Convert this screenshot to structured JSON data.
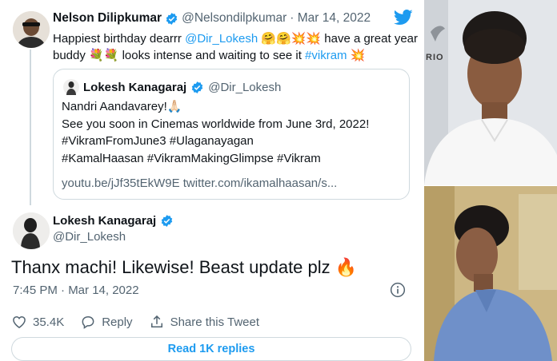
{
  "tweet": {
    "author_name": "Nelson Dilipkumar",
    "author_handle": "@Nelsondilpkumar",
    "date": "· Mar 14, 2022",
    "text_line1_prefix": "Happiest birthday dearrr ",
    "mention": "@Dir_Lokesh",
    "text_line1_suffix": " have a great year",
    "text_line2_prefix": "buddy ",
    "text_line2_middle": " looks intense and waiting to see it ",
    "hashtag": "#vikram"
  },
  "quote": {
    "author_name": "Lokesh Kanagaraj",
    "author_handle": "@Dir_Lokesh",
    "line1": "Nandri Aandavarey!🙏🏻",
    "line2": "See you soon in Cinemas worldwide from June 3rd, 2022!",
    "line3": "#VikramFromJune3 #Ulaganayagan",
    "line4": "#KamalHaasan #VikramMakingGlimpse #Vikram",
    "links": "youtu.be/jJf35tEkW9E twitter.com/ikamalhaasan/s..."
  },
  "reply": {
    "author_name": "Lokesh Kanagaraj",
    "author_handle": "@Dir_Lokesh",
    "text": "Thanx machi! Likewise! Beast update plz",
    "emoji": "🔥",
    "time": "7:45 PM · Mar 14, 2022"
  },
  "actions": {
    "likes": "35.4K",
    "reply_label": "Reply",
    "share_label": "Share this Tweet"
  },
  "read_replies_label": "Read 1K replies",
  "photos": {
    "top_caption": "RIO",
    "top_subject": "man with curly hair in white shirt",
    "bottom_subject": "man in blue shirt"
  },
  "colors": {
    "accent": "#1d9bf0",
    "text": "#0f1419",
    "muted": "#536471",
    "border": "#cfd9de"
  },
  "icons": [
    "verified-badge-icon",
    "twitter-bird-icon",
    "heart-icon",
    "reply-bubble-icon",
    "share-icon",
    "info-icon"
  ]
}
